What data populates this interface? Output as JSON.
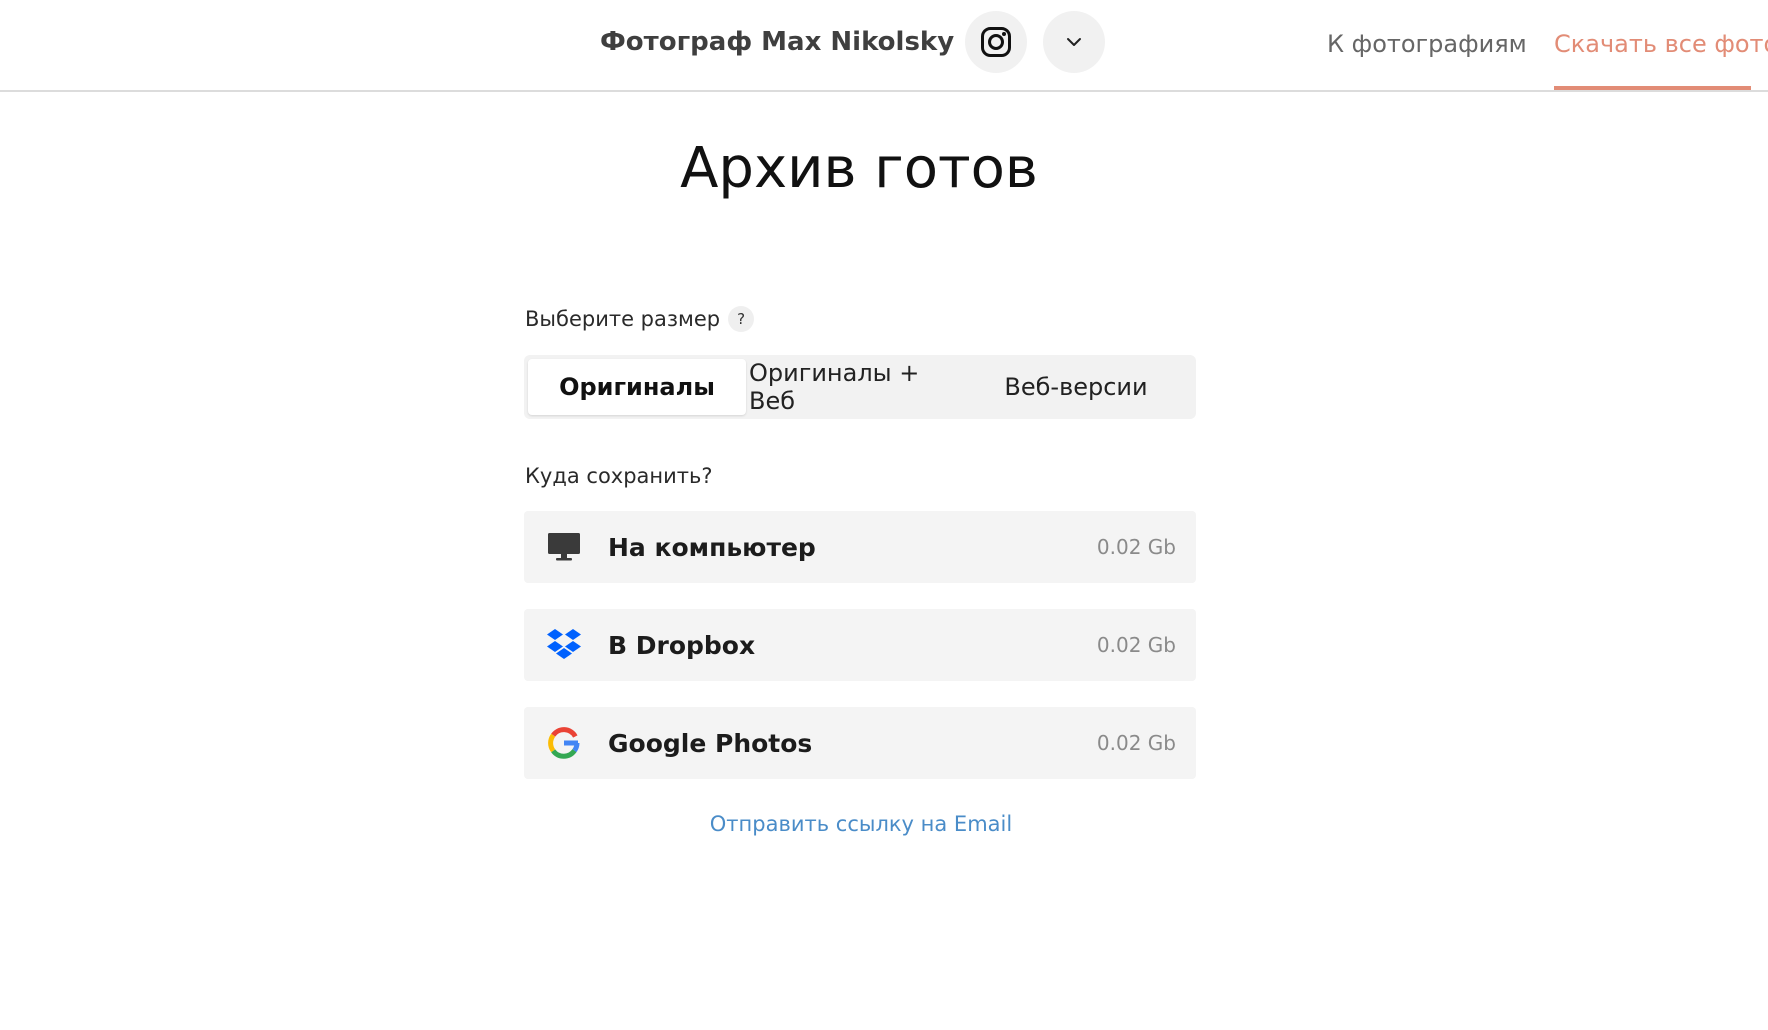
{
  "header": {
    "brand": "Фотограф Max Nikolsky",
    "instagram_icon": "instagram-icon",
    "more_icon": "chevron-down-icon",
    "nav": {
      "back_label": "К фотографиям",
      "download_label": "Скачать все фото"
    },
    "accent_color": "#e28c76"
  },
  "main": {
    "title": "Архив готов",
    "size_label": "Выберите размер",
    "help_label": "?",
    "size_options": [
      {
        "label": "Оригиналы",
        "selected": true
      },
      {
        "label": "Оригиналы + Веб",
        "selected": false
      },
      {
        "label": "Веб-версии",
        "selected": false
      }
    ],
    "save_label": "Куда сохранить?",
    "destinations": [
      {
        "label": "На компьютер",
        "size": "0.02 Gb",
        "icon": "monitor-icon"
      },
      {
        "label": "В Dropbox",
        "size": "0.02 Gb",
        "icon": "dropbox-icon"
      },
      {
        "label": "Google Photos",
        "size": "0.02 Gb",
        "icon": "google-icon"
      }
    ],
    "email_link": "Отправить ссылку на Email",
    "link_color": "#4a8cc8"
  }
}
